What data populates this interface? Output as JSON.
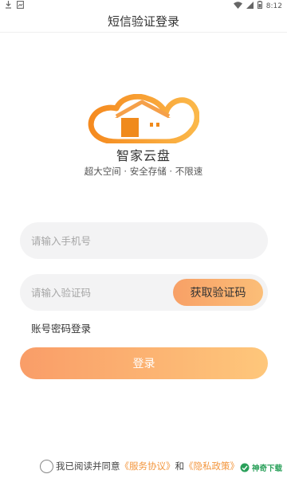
{
  "status_bar": {
    "time": "8:12"
  },
  "header": {
    "title": "短信验证登录"
  },
  "brand": {
    "app_name": "智家云盘",
    "slogan": "超大空间 · 安全存储 · 不限速"
  },
  "form": {
    "phone_placeholder": "请输入手机号",
    "code_placeholder": "请输入验证码",
    "get_code_label": "获取验证码",
    "password_login_label": "账号密码登录",
    "login_label": "登录"
  },
  "agreement": {
    "prefix": "我已阅读并同意",
    "terms_link": "《服务协议》",
    "conjunction": "和",
    "privacy_link": "《隐私政策》"
  },
  "watermark": {
    "text": "神奇下载"
  },
  "colors": {
    "accent": "#f5a05a",
    "link": "#f3963d",
    "field_bg": "#f3f3f4"
  },
  "icons": [
    "download-icon",
    "notification-icon",
    "wifi-icon",
    "signal-icon",
    "battery-icon",
    "house-cloud-logo"
  ]
}
